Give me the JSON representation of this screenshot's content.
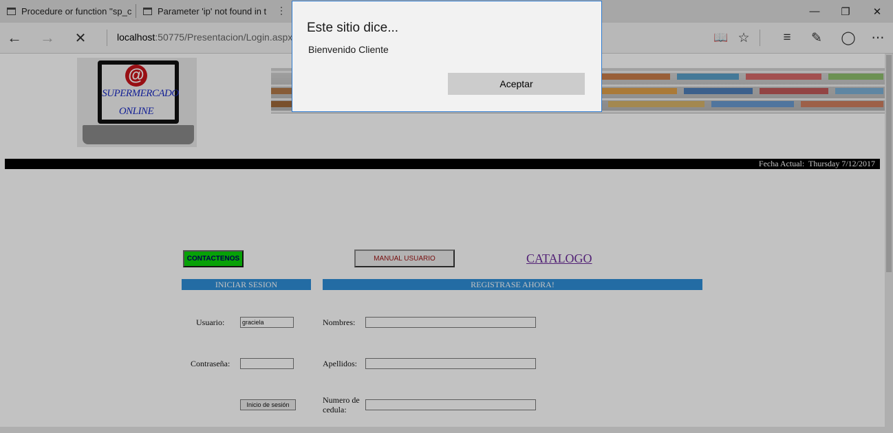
{
  "browser": {
    "tabs": [
      {
        "title": "Procedure or function ''sp_c"
      },
      {
        "title": "Parameter 'ip' not found in t"
      }
    ],
    "address": {
      "host": "localhost",
      "rest": ":50775/Presentacion/Login.aspx"
    },
    "window_controls": {
      "minimize": "—",
      "restore": "❐",
      "close": "✕"
    }
  },
  "page": {
    "logo": {
      "line1": "SUPERMERCADO",
      "line2": "ONLINE",
      "symbol": "@"
    },
    "date_bar": {
      "label": "Fecha Actual:",
      "value": "Thursday 7/12/2017"
    },
    "buttons": {
      "contact": "CONTACTENOS",
      "manual": "MANUAL USUARIO",
      "catalog": "CATALOGO"
    },
    "login": {
      "header": "INICIAR SESION",
      "user_label": "Usuario:",
      "user_value": "graciela",
      "password_label": "Contraseña:",
      "password_value": "",
      "submit": "Inicio de sesión"
    },
    "register": {
      "header": "REGISTRASE AHORA!",
      "first_name_label": "Nombres:",
      "last_name_label": "Apellidos:",
      "id_label_1": "Numero de",
      "id_label_2": "cedula:"
    }
  },
  "dialog": {
    "title": "Este sitio dice...",
    "message": "Bienvenido Cliente",
    "ok": "Aceptar"
  }
}
